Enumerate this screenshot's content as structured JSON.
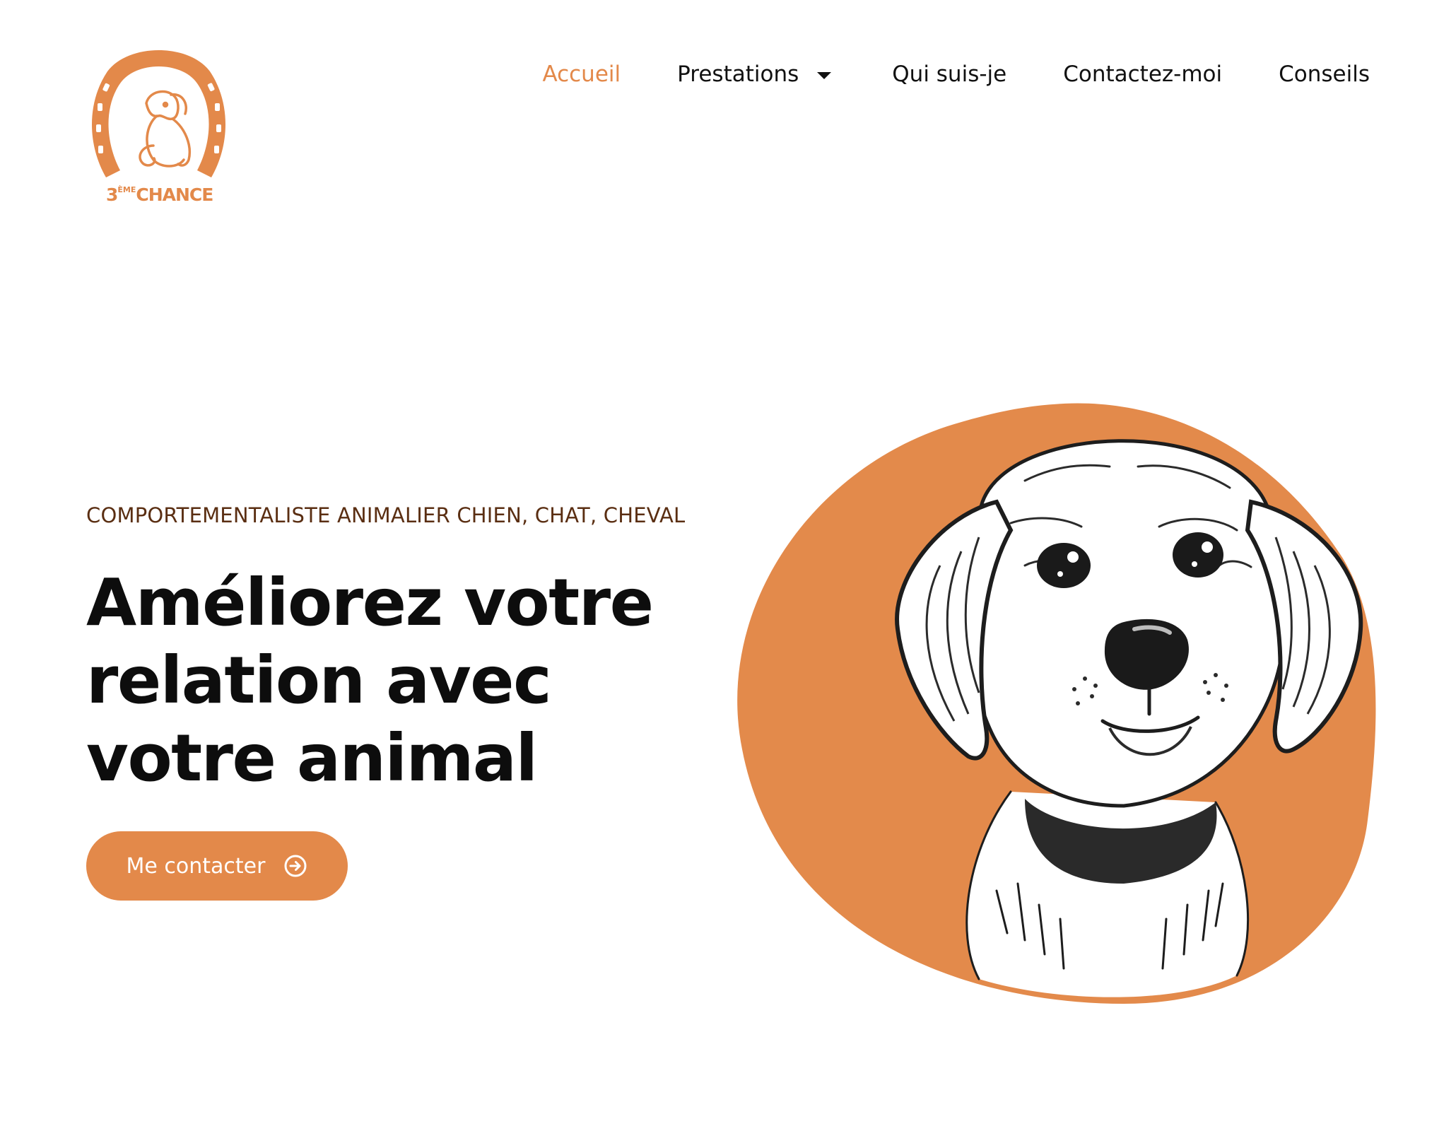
{
  "brand": {
    "logo_prefix": "3",
    "logo_sup": "ÈME",
    "logo_word": "CHANCE",
    "accent_color": "#e3894a"
  },
  "nav": {
    "items": [
      {
        "label": "Accueil",
        "active": true
      },
      {
        "label": "Prestations",
        "has_dropdown": true
      },
      {
        "label": "Qui suis-je"
      },
      {
        "label": "Contactez-moi"
      },
      {
        "label": "Conseils"
      }
    ]
  },
  "hero": {
    "eyebrow": "COMPORTEMENTALISTE ANIMALIER CHIEN, CHAT, CHEVAL",
    "headline_line1": "Améliorez votre",
    "headline_line2": "relation avec",
    "headline_line3": "votre animal",
    "cta_label": "Me contacter",
    "cta_icon": "arrow-circle-right-icon",
    "image_icon": "puppy-illustration"
  }
}
